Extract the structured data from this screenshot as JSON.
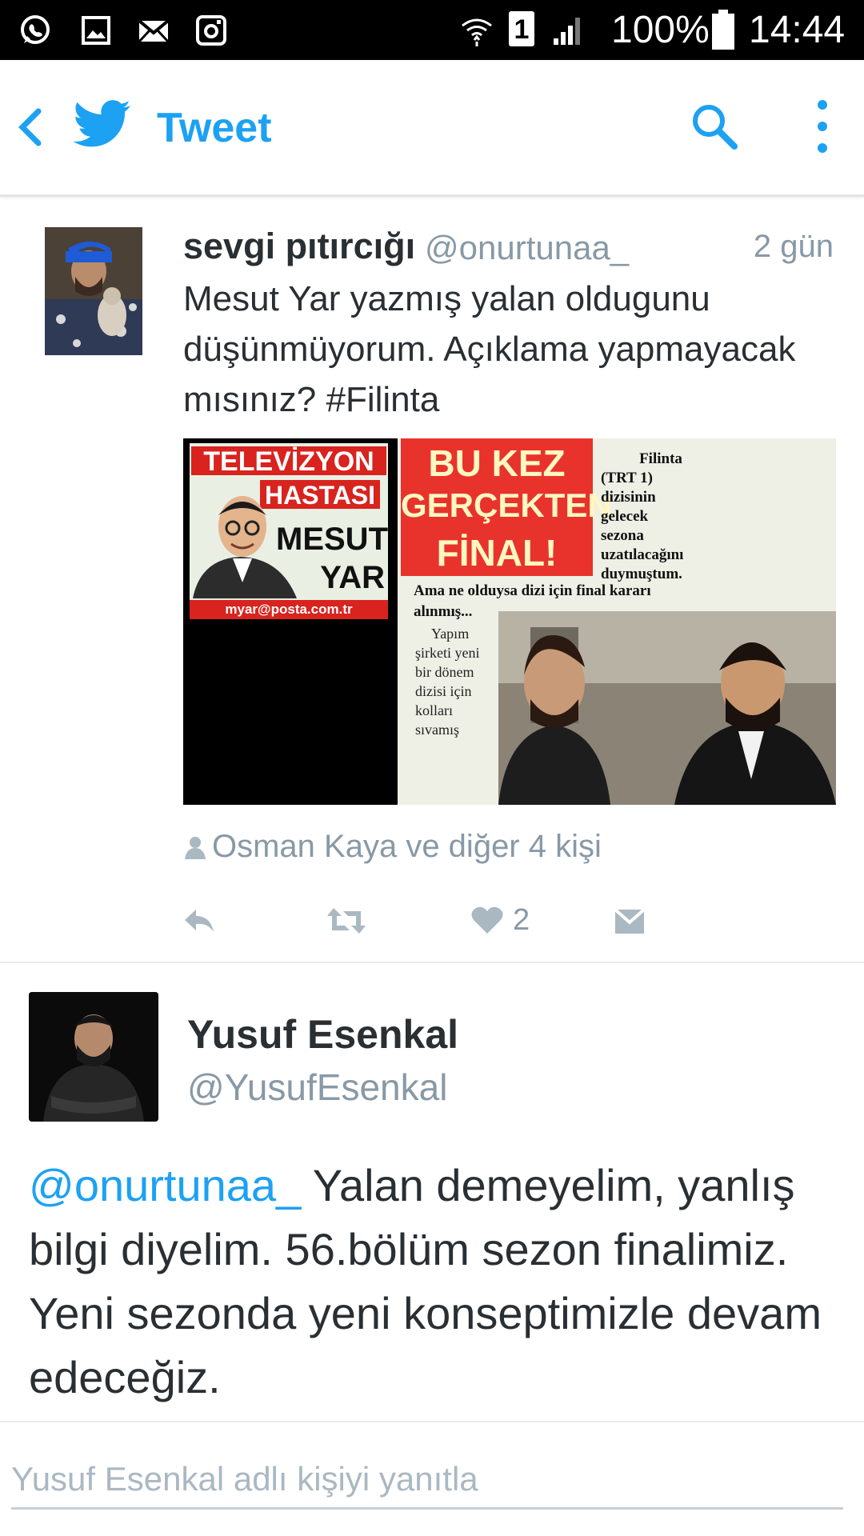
{
  "status_bar": {
    "battery": "100%",
    "time": "14:44",
    "sim_badge": "1",
    "icons": [
      "whatsapp-icon",
      "gallery-icon",
      "mail-icon",
      "instagram-icon",
      "wifi-icon",
      "sim-icon",
      "signal-icon",
      "battery-icon"
    ]
  },
  "app_bar": {
    "title": "Tweet",
    "icons": [
      "back-icon",
      "twitter-bird-icon",
      "search-icon",
      "overflow-menu-icon"
    ],
    "accent_color": "#1da1f2"
  },
  "tweet": {
    "name": "sevgi pıtırcığı",
    "handle": "@onurtunaa_",
    "time": "2 gün",
    "text": "Mesut Yar yazmış yalan oldugunu düşünmüyorum. Açıklama yapmayacak mısınız? #Filinta",
    "media": {
      "left": {
        "header_line1": "TELEVİZYON",
        "header_line2": "HASTASI",
        "name_line1": "MESUT",
        "name_line2": "YAR",
        "email": "myar@posta.com.tr"
      },
      "right": {
        "headline_line1": "BU KEZ",
        "headline_line2": "GERÇEKTEN",
        "headline_line3": "FİNAL!",
        "side_text": [
          "Filinta",
          "(TRT 1)",
          "dizisinin",
          "gelecek",
          "sezona",
          "uzatılacağını",
          "duymuştum."
        ],
        "body_line1": "Ama ne olduysa dizi için final kararı",
        "body_line2": "alınmış...",
        "body_col": [
          "Yapım",
          "şirketi yeni",
          "bir dönem",
          "dizisi için",
          "kolları",
          "sıvamış"
        ]
      }
    },
    "social_context": "Osman Kaya ve diğer 4 kişi",
    "like_count": "2"
  },
  "reply_tweet": {
    "name": "Yusuf Esenkal",
    "handle": "@YusufEsenkal",
    "mention": "@onurtunaa_",
    "text": " Yalan demeyelim, yanlış bilgi diyelim. 56.bölüm sezon finalimiz. Yeni sezonda yeni konseptimizle devam edeceğiz."
  },
  "reply_box": {
    "placeholder": "Yusuf Esenkal adlı kişiyi yanıtla"
  }
}
